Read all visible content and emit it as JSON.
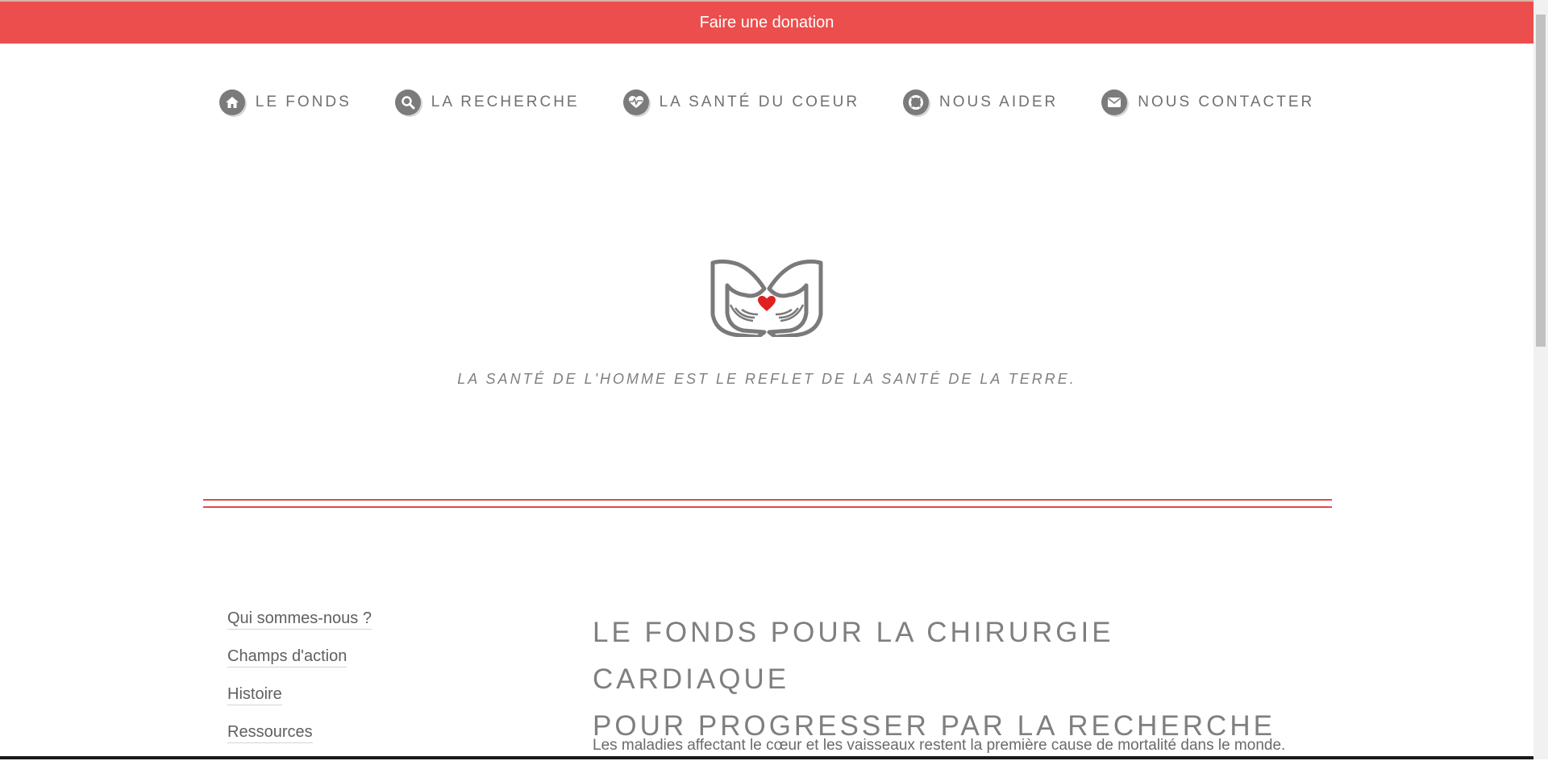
{
  "donation": {
    "label": "Faire une donation"
  },
  "nav": {
    "items": [
      {
        "label": "LE FONDS",
        "icon": "home-icon"
      },
      {
        "label": "LA RECHERCHE",
        "icon": "search-icon"
      },
      {
        "label": "LA SANTÉ DU COEUR",
        "icon": "heart-pulse-icon"
      },
      {
        "label": "NOUS AIDER",
        "icon": "lifebuoy-icon"
      },
      {
        "label": "NOUS CONTACTER",
        "icon": "envelope-icon"
      }
    ]
  },
  "hero": {
    "tagline": "LA SANTÉ DE L'HOMME EST LE REFLET DE LA SANTÉ DE LA TERRE."
  },
  "sidebar": {
    "links": [
      "Qui sommes-nous ?",
      "Champs d'action",
      "Histoire",
      "Ressources"
    ]
  },
  "main": {
    "headline_line1": "LE FONDS POUR LA CHIRURGIE CARDIAQUE",
    "headline_line2": "POUR PROGRESSER PAR LA RECHERCHE",
    "intro": "Les maladies affectant le cœur et les vaisseaux restent la première cause de mortalité dans le monde."
  },
  "colors": {
    "accent": "#ec4e4d",
    "icon_grey": "#7b7b7b",
    "heart": "#e02020"
  }
}
